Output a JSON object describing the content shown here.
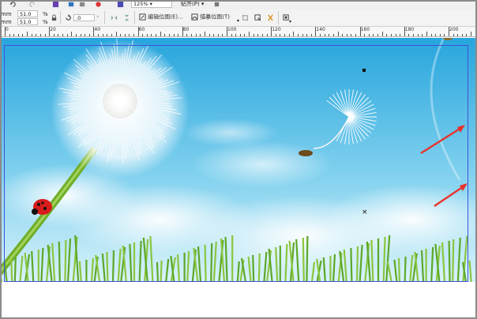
{
  "toolbar": {
    "zoom": "125%",
    "snap_to": "贴齐(P)",
    "width_label": "mm",
    "height_label": "mm",
    "width_value": "51.0",
    "height_value": "51.0",
    "percent": "%",
    "rotation": ".0",
    "edit_bitmap_label": "编辑位图(E)...",
    "trace_bitmap_label": "描摹位图(T)"
  },
  "ruler": {
    "labels": [
      "0",
      "20",
      "40",
      "60",
      "80",
      "100",
      "120",
      "140",
      "160",
      "180",
      "200"
    ]
  },
  "colors": {
    "sky_top": "#2aa7de",
    "sky_bottom": "#bfeaf6",
    "selection": "#3f52d8",
    "arrow": "#e8322b"
  },
  "icons": [
    "undo-icon",
    "redo-icon",
    "import-icon",
    "export-icon",
    "lock-ratio-icon",
    "rotate-icon",
    "mirror-h-icon",
    "mirror-v-icon",
    "edit-bitmap-icon",
    "trace-bitmap-icon",
    "crop-icon",
    "resample-icon",
    "bitmap-color-mask-icon",
    "options-icon"
  ]
}
